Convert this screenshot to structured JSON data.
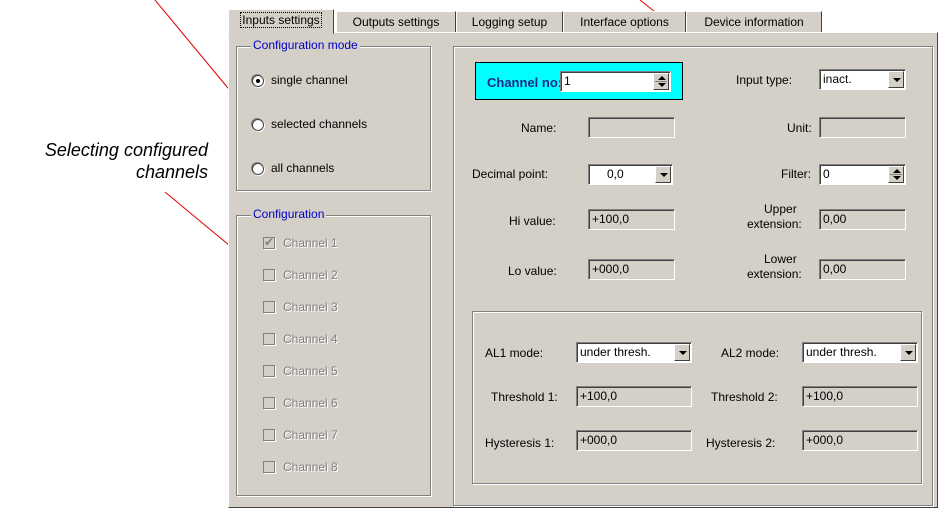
{
  "callout": {
    "line1": "Selecting configured",
    "line2": "channels"
  },
  "tabs": [
    "Inputs settings",
    "Outputs settings",
    "Logging setup",
    "Interface options",
    "Device information"
  ],
  "config_mode": {
    "legend": "Configuration mode",
    "options": [
      {
        "label": "single channel",
        "checked": true
      },
      {
        "label": "selected channels",
        "checked": false
      },
      {
        "label": "all channels",
        "checked": false
      }
    ]
  },
  "configuration": {
    "legend": "Configuration",
    "channels": [
      {
        "label": "Channel 1",
        "checked": true
      },
      {
        "label": "Channel 2",
        "checked": false
      },
      {
        "label": "Channel 3",
        "checked": false
      },
      {
        "label": "Channel 4",
        "checked": false
      },
      {
        "label": "Channel 5",
        "checked": false
      },
      {
        "label": "Channel 6",
        "checked": false
      },
      {
        "label": "Channel 7",
        "checked": false
      },
      {
        "label": "Channel 8",
        "checked": false
      }
    ]
  },
  "channel": {
    "label": "Channel no:",
    "value": "1",
    "bg_color": "#00ffff"
  },
  "input_type": {
    "label": "Input type:",
    "value": "inact."
  },
  "name": {
    "label": "Name:",
    "value": ""
  },
  "unit": {
    "label": "Unit:",
    "value": ""
  },
  "decimal_point": {
    "label": "Decimal point:",
    "value": "0,0"
  },
  "filter": {
    "label": "Filter:",
    "value": "0"
  },
  "hi_value": {
    "label": "Hi value:",
    "value": "+100,0"
  },
  "upper_ext": {
    "label1": "Upper",
    "label2": "extension:",
    "value": "0,00"
  },
  "lo_value": {
    "label": "Lo value:",
    "value": "+000,0"
  },
  "lower_ext": {
    "label1": "Lower",
    "label2": "extension:",
    "value": "0,00"
  },
  "alarms": {
    "al1_mode": {
      "label": "AL1 mode:",
      "value": "under thresh."
    },
    "al2_mode": {
      "label": "AL2 mode:",
      "value": "under thresh."
    },
    "threshold1": {
      "label": "Threshold 1:",
      "value": "+100,0"
    },
    "threshold2": {
      "label": "Threshold 2:",
      "value": "+100,0"
    },
    "hysteresis1": {
      "label": "Hysteresis 1:",
      "value": "+000,0"
    },
    "hysteresis2": {
      "label": "Hysteresis 2:",
      "value": "+000,0"
    }
  },
  "colors": {
    "arrow": "#e00000",
    "legend": "#0000c8",
    "window_bg": "#d4d0c8"
  }
}
